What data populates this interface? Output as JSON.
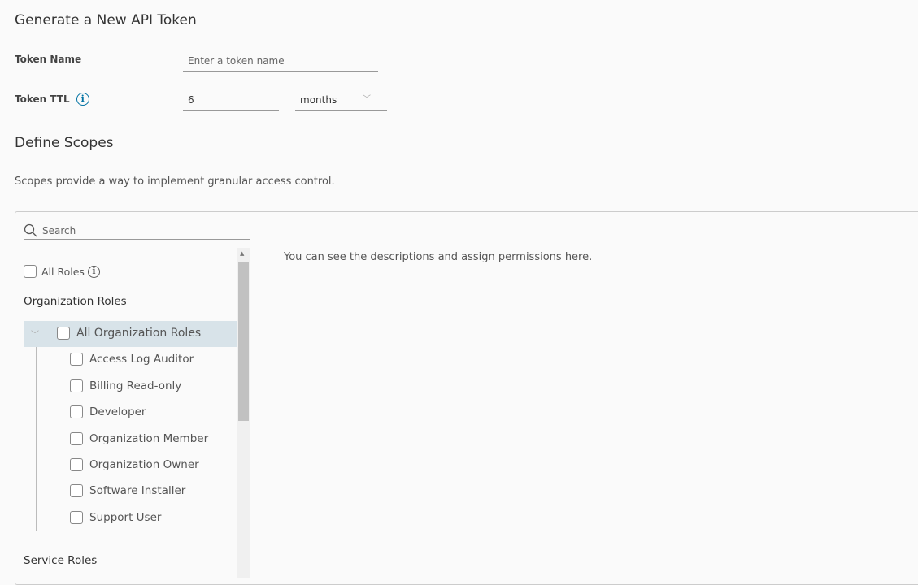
{
  "title": "Generate a New API Token",
  "token_name": {
    "label": "Token Name",
    "placeholder": "Enter a token name",
    "value": ""
  },
  "token_ttl": {
    "label": "Token TTL",
    "value": "6",
    "unit": "months"
  },
  "scopes": {
    "title": "Define Scopes",
    "description": "Scopes provide a way to implement granular access control.",
    "search_placeholder": "Search",
    "all_roles": "All Roles",
    "org_section": "Organization Roles",
    "all_org_roles": "All Organization Roles",
    "org_roles": [
      "Access Log Auditor",
      "Billing Read-only",
      "Developer",
      "Organization Member",
      "Organization Owner",
      "Software Installer",
      "Support User"
    ],
    "service_section": "Service Roles",
    "detail_hint": "You can see the descriptions and assign permissions here."
  },
  "colors": {
    "accent": "#0072a3",
    "selected_row": "#d8e3e9"
  }
}
